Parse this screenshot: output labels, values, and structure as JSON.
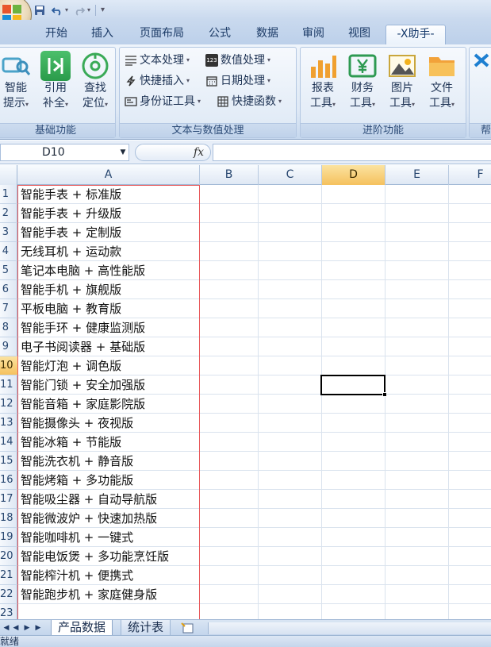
{
  "quick_access": {
    "save_icon": "save-icon",
    "undo_icon": "undo-icon",
    "redo_icon": "redo-icon"
  },
  "tabs": [
    {
      "label": "开始"
    },
    {
      "label": "插入"
    },
    {
      "label": "页面布局"
    },
    {
      "label": "公式"
    },
    {
      "label": "数据"
    },
    {
      "label": "审阅"
    },
    {
      "label": "视图"
    },
    {
      "label": "-X助手-"
    }
  ],
  "ribbon": {
    "basic": {
      "label": "基础功能",
      "smart_hint": [
        "智能",
        "提示"
      ],
      "ref_complete": [
        "引用",
        "补全"
      ],
      "find_locate": [
        "查找",
        "定位"
      ]
    },
    "text_number": {
      "label": "文本与数值处理",
      "text_process": "文本处理",
      "number_process": "数值处理",
      "quick_insert": "快捷插入",
      "date_process": "日期处理",
      "id_tool": "身份证工具",
      "quick_func": "快捷函数"
    },
    "advanced": {
      "label": "进阶功能",
      "report": [
        "报表",
        "工具"
      ],
      "finance": [
        "财务",
        "工具"
      ],
      "image": [
        "图片",
        "工具"
      ],
      "file": [
        "文件",
        "工具"
      ]
    },
    "help": {
      "label": "帮"
    }
  },
  "formula_bar": {
    "name_box": "D10",
    "fx": "fx",
    "value": ""
  },
  "columns": [
    "A",
    "B",
    "C",
    "D",
    "E",
    "F"
  ],
  "rows": [
    "1",
    "2",
    "3",
    "4",
    "5",
    "6",
    "7",
    "8",
    "9",
    "10",
    "11",
    "12",
    "13",
    "14",
    "15",
    "16",
    "17",
    "18",
    "19",
    "20",
    "21",
    "22",
    "23"
  ],
  "cells_a": [
    "智能手表 + 标准版",
    "智能手表 + 升级版",
    "智能手表 + 定制版",
    "无线耳机 + 运动款",
    "笔记本电脑 + 高性能版",
    "智能手机 + 旗舰版",
    "平板电脑 + 教育版",
    "智能手环 + 健康监测版",
    "电子书阅读器 + 基础版",
    "智能灯泡 + 调色版",
    "智能门锁 + 安全加强版",
    "智能音箱 + 家庭影院版",
    "智能摄像头 + 夜视版",
    "智能冰箱 + 节能版",
    "智能洗衣机 + 静音版",
    "智能烤箱 + 多功能版",
    "智能吸尘器 + 自动导航版",
    "智能微波炉 + 快速加热版",
    "智能咖啡机 + 一键式",
    "智能电饭煲 + 多功能烹饪版",
    "智能榨汁机 + 便携式",
    "智能跑步机 + 家庭健身版"
  ],
  "sheets": [
    {
      "label": "产品数据"
    },
    {
      "label": "统计表"
    }
  ],
  "status": {
    "text": "就绪"
  },
  "colors": {
    "accent_tab": "#15396b",
    "selection_border": "#e8595b",
    "header_selected": "#f5c15e"
  }
}
